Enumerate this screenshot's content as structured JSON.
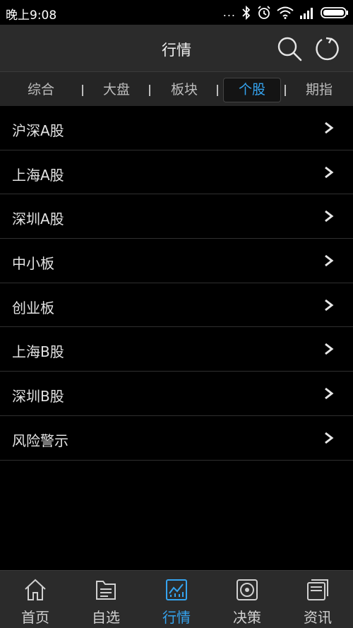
{
  "status_bar": {
    "time": "晚上9:08",
    "dots": "..."
  },
  "header": {
    "title": "行情"
  },
  "tabs": [
    {
      "label": "综合",
      "active": false
    },
    {
      "label": "大盘",
      "active": false
    },
    {
      "label": "板块",
      "active": false
    },
    {
      "label": "个股",
      "active": true
    },
    {
      "label": "期指",
      "active": false
    }
  ],
  "list": [
    {
      "label": "沪深A股"
    },
    {
      "label": "上海A股"
    },
    {
      "label": "深圳A股"
    },
    {
      "label": "中小板"
    },
    {
      "label": "创业板"
    },
    {
      "label": "上海B股"
    },
    {
      "label": "深圳B股"
    },
    {
      "label": "风险警示"
    }
  ],
  "bottom_nav": [
    {
      "label": "首页",
      "icon": "home-icon",
      "active": false
    },
    {
      "label": "自选",
      "icon": "folder-icon",
      "active": false
    },
    {
      "label": "行情",
      "icon": "chart-icon",
      "active": true
    },
    {
      "label": "决策",
      "icon": "target-icon",
      "active": false
    },
    {
      "label": "资讯",
      "icon": "news-icon",
      "active": false
    }
  ],
  "colors": {
    "accent": "#35a4f0",
    "background": "#000000",
    "header": "#2b2b2b"
  }
}
